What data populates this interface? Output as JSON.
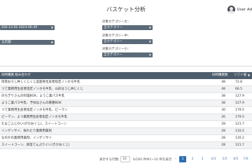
{
  "header": {
    "title": "バスケット分析",
    "user": "User Ad"
  },
  "filters": {
    "date_range": "202-12-01-2023-06-30",
    "store": "全店舗",
    "cat_large_label": "対象カテゴリー大：",
    "cat_large_value": "全カテゴリー",
    "cat_mid_label": "対象カテゴリー中：",
    "cat_mid_value": "全カテゴリー",
    "cat_small_label": "対象カテゴリー小：",
    "cat_small_value": "全カテゴリー"
  },
  "table": {
    "columns": {
      "name": "同時購買 組み合わせ",
      "count": "同時購買数",
      "lift": "リフト値"
    },
    "rows": [
      {
        "name": "肉巻おろし丼しくじくじ変超骨生産者指定ノンホモ牛乳",
        "count": "48",
        "lift": "72.8"
      },
      {
        "name": "つて業務用生産者指定ノンホモ牛乳、山形はうじ丼じくじ",
        "count": "48",
        "lift": "66.5"
      },
      {
        "name": "のちぎりさんの料理BOX、ようこ業パス牛乳",
        "count": "38",
        "lift": "127.9"
      },
      {
        "name": "ようこ業パス牛乳、予拭はさんの麻婆BOX",
        "count": "38",
        "lift": "127.9"
      },
      {
        "name": "つて業務用生産者指定ノンホモ牛乳、ピーマン",
        "count": "30",
        "lift": "179.5"
      },
      {
        "name": "ピーマン、よつ業務用生産者指定ノンホモ牛乳",
        "count": "30",
        "lift": "179.5"
      },
      {
        "name": "たまごふじかい(がかおくじ)、スイートコーン",
        "count": "28",
        "lift": "121.7"
      },
      {
        "name": "インゲンサイ、採れたり業務用薬剤",
        "count": "28",
        "lift": "110.2"
      },
      {
        "name": "なのかの業務用薬剤、インゲンサイ",
        "count": "28",
        "lift": "116.2"
      },
      {
        "name": "スイートコーン、卵温てんぷりぐい(きかおくじ)",
        "count": "28",
        "lift": "121.7"
      }
    ]
  },
  "pager": {
    "per_page_label": "表示する行数:",
    "per_page_value": "10",
    "range_text": "6/160 件中1~10 件を表示",
    "pages": [
      "‹",
      "1",
      "2",
      "3",
      "4/3",
      "5/5",
      "6/5",
      "7/6"
    ]
  },
  "colors": {
    "header_bg": "#4e5d6c",
    "filter_bg": "#5b6a78",
    "accent": "#2f6fb0"
  }
}
